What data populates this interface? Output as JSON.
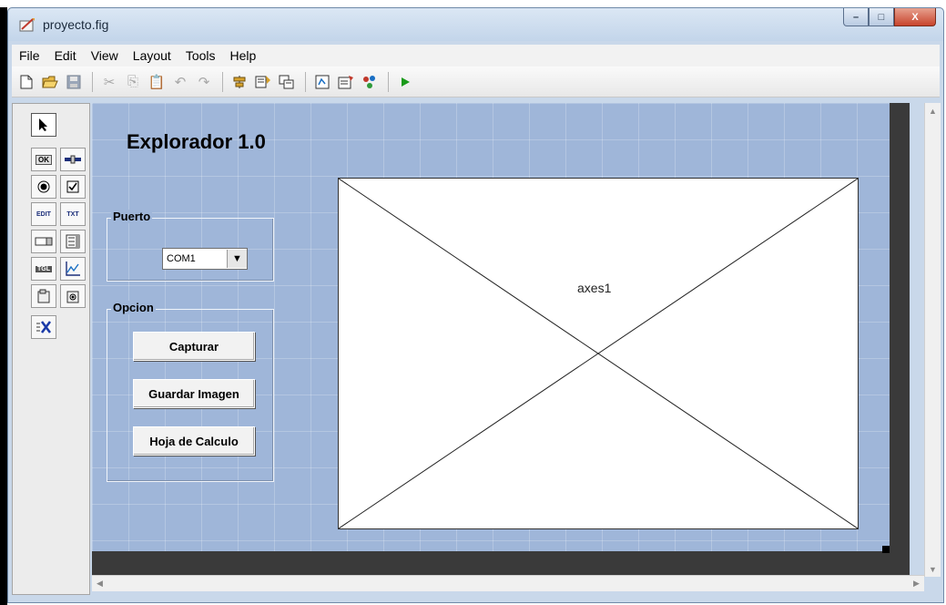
{
  "window": {
    "title": "proyecto.fig",
    "minimize_glyph": "–",
    "maximize_glyph": "□",
    "close_glyph": "X"
  },
  "menu": [
    "File",
    "Edit",
    "View",
    "Layout",
    "Tools",
    "Help"
  ],
  "toolbar": {
    "icons": [
      "new-icon",
      "open-icon",
      "save-icon",
      "cut-icon",
      "copy-icon",
      "paste-icon",
      "undo-icon",
      "redo-icon",
      "align-icon",
      "menu-editor-icon",
      "tab-order-icon",
      "mfile-editor-icon",
      "property-inspector-icon",
      "object-browser-icon",
      "run-icon"
    ]
  },
  "palette": {
    "items": [
      "select-tool",
      "push-button-tool",
      "slider-tool",
      "radio-button-tool",
      "checkbox-tool",
      "edit-text-tool",
      "static-text-tool",
      "popup-menu-tool",
      "listbox-tool",
      "toggle-button-tool",
      "axes-tool",
      "panel-tool",
      "button-group-tool",
      "activex-tool"
    ],
    "labels": {
      "push": "OK",
      "edit": "EDIT",
      "text": "TXT",
      "toggle": "TGL"
    }
  },
  "gui": {
    "title": "Explorador 1.0",
    "port_panel": {
      "title": "Puerto",
      "selected": "COM1"
    },
    "option_panel": {
      "title": "Opcion",
      "buttons": [
        "Capturar",
        "Guardar Imagen",
        "Hoja de Calculo"
      ]
    },
    "axes_label": "axes1"
  },
  "colors": {
    "canvas": "#9fb6d9",
    "frame": "#c9d8ea",
    "run_green": "#1a9a1a"
  }
}
